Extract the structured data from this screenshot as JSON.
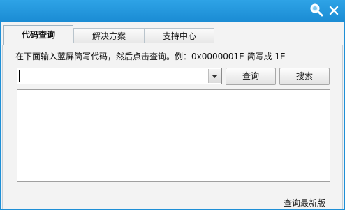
{
  "titlebar": {
    "search_icon": "search-icon",
    "close_label": "x"
  },
  "tabs": [
    {
      "label": "代码查询",
      "active": true
    },
    {
      "label": "解决方案",
      "active": false
    },
    {
      "label": "支持中心",
      "active": false
    }
  ],
  "main": {
    "hint": "在下面输入蓝屏简写代码，然后点击查询。例：0x0000001E 简写成 1E",
    "code_input_value": "",
    "query_button": "查询",
    "search_button": "搜索",
    "result_text": ""
  },
  "footer": {
    "update_link": "查询最新版"
  },
  "colors": {
    "titlebar": "#1e8fd6",
    "client_bg": "#f3f3f3"
  }
}
